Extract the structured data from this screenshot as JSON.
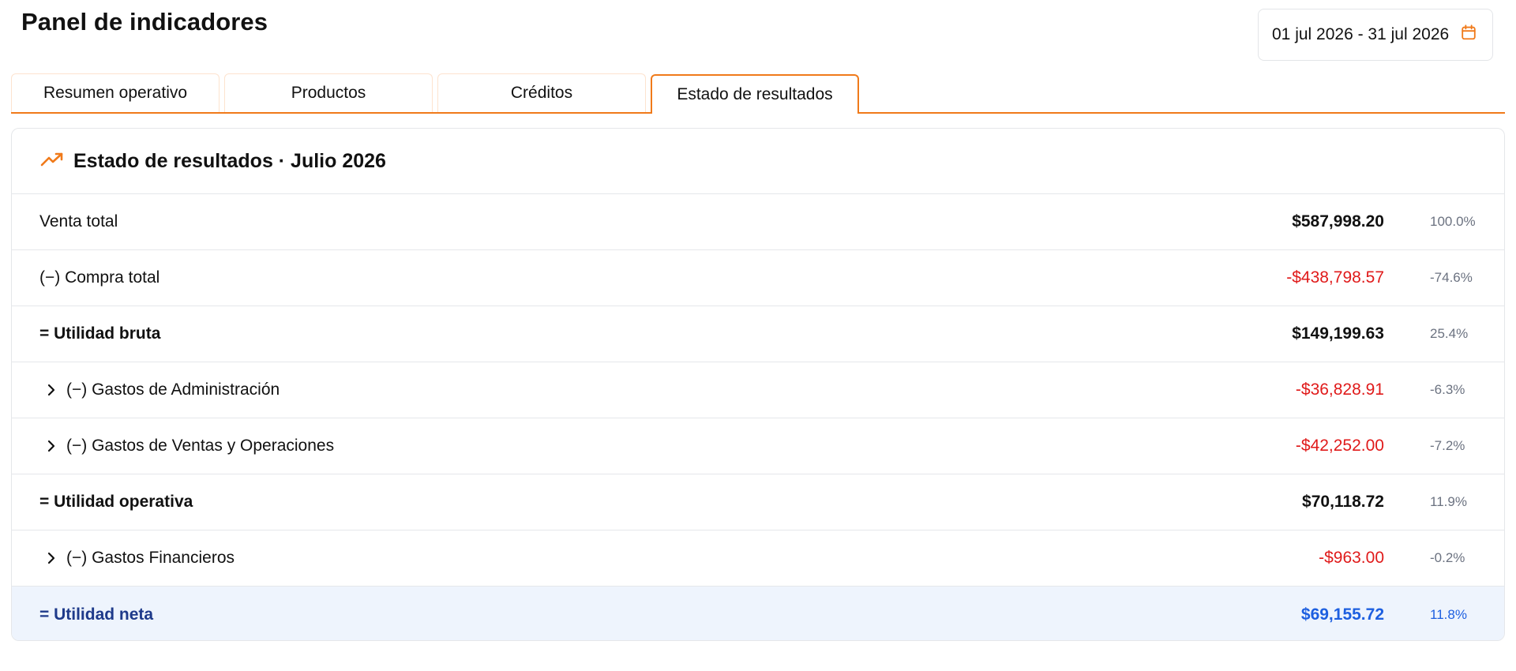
{
  "header": {
    "title": "Panel de indicadores",
    "date_range": "01 jul 2026 - 31 jul 2026"
  },
  "colors": {
    "accent": "#f07a1a",
    "negative": "#e01a1a",
    "net_text": "#1e3a8a",
    "net_amount": "#1d5fe0",
    "net_background": "#eef4fd"
  },
  "tabs": [
    {
      "label": "Resumen operativo",
      "active": false
    },
    {
      "label": "Productos",
      "active": false
    },
    {
      "label": "Créditos",
      "active": false
    },
    {
      "label": "Estado de resultados",
      "active": true
    }
  ],
  "card": {
    "icon": "trending-up-icon",
    "title": "Estado de resultados · Julio 2026"
  },
  "rows": [
    {
      "label": "Venta total",
      "amount": "$587,998.20",
      "pct": "100.0%"
    },
    {
      "label": "(−) Compra total",
      "amount": "-$438,798.57",
      "pct": "-74.6%"
    },
    {
      "label": "= Utilidad bruta",
      "amount": "$149,199.63",
      "pct": "25.4%"
    },
    {
      "label": "(−) Gastos de Administración",
      "amount": "-$36,828.91",
      "pct": "-6.3%"
    },
    {
      "label": "(−) Gastos de Ventas y Operaciones",
      "amount": "-$42,252.00",
      "pct": "-7.2%"
    },
    {
      "label": "= Utilidad operativa",
      "amount": "$70,118.72",
      "pct": "11.9%"
    },
    {
      "label": "(−) Gastos Financieros",
      "amount": "-$963.00",
      "pct": "-0.2%"
    },
    {
      "label": "= Utilidad neta",
      "amount": "$69,155.72",
      "pct": "11.8%"
    }
  ]
}
